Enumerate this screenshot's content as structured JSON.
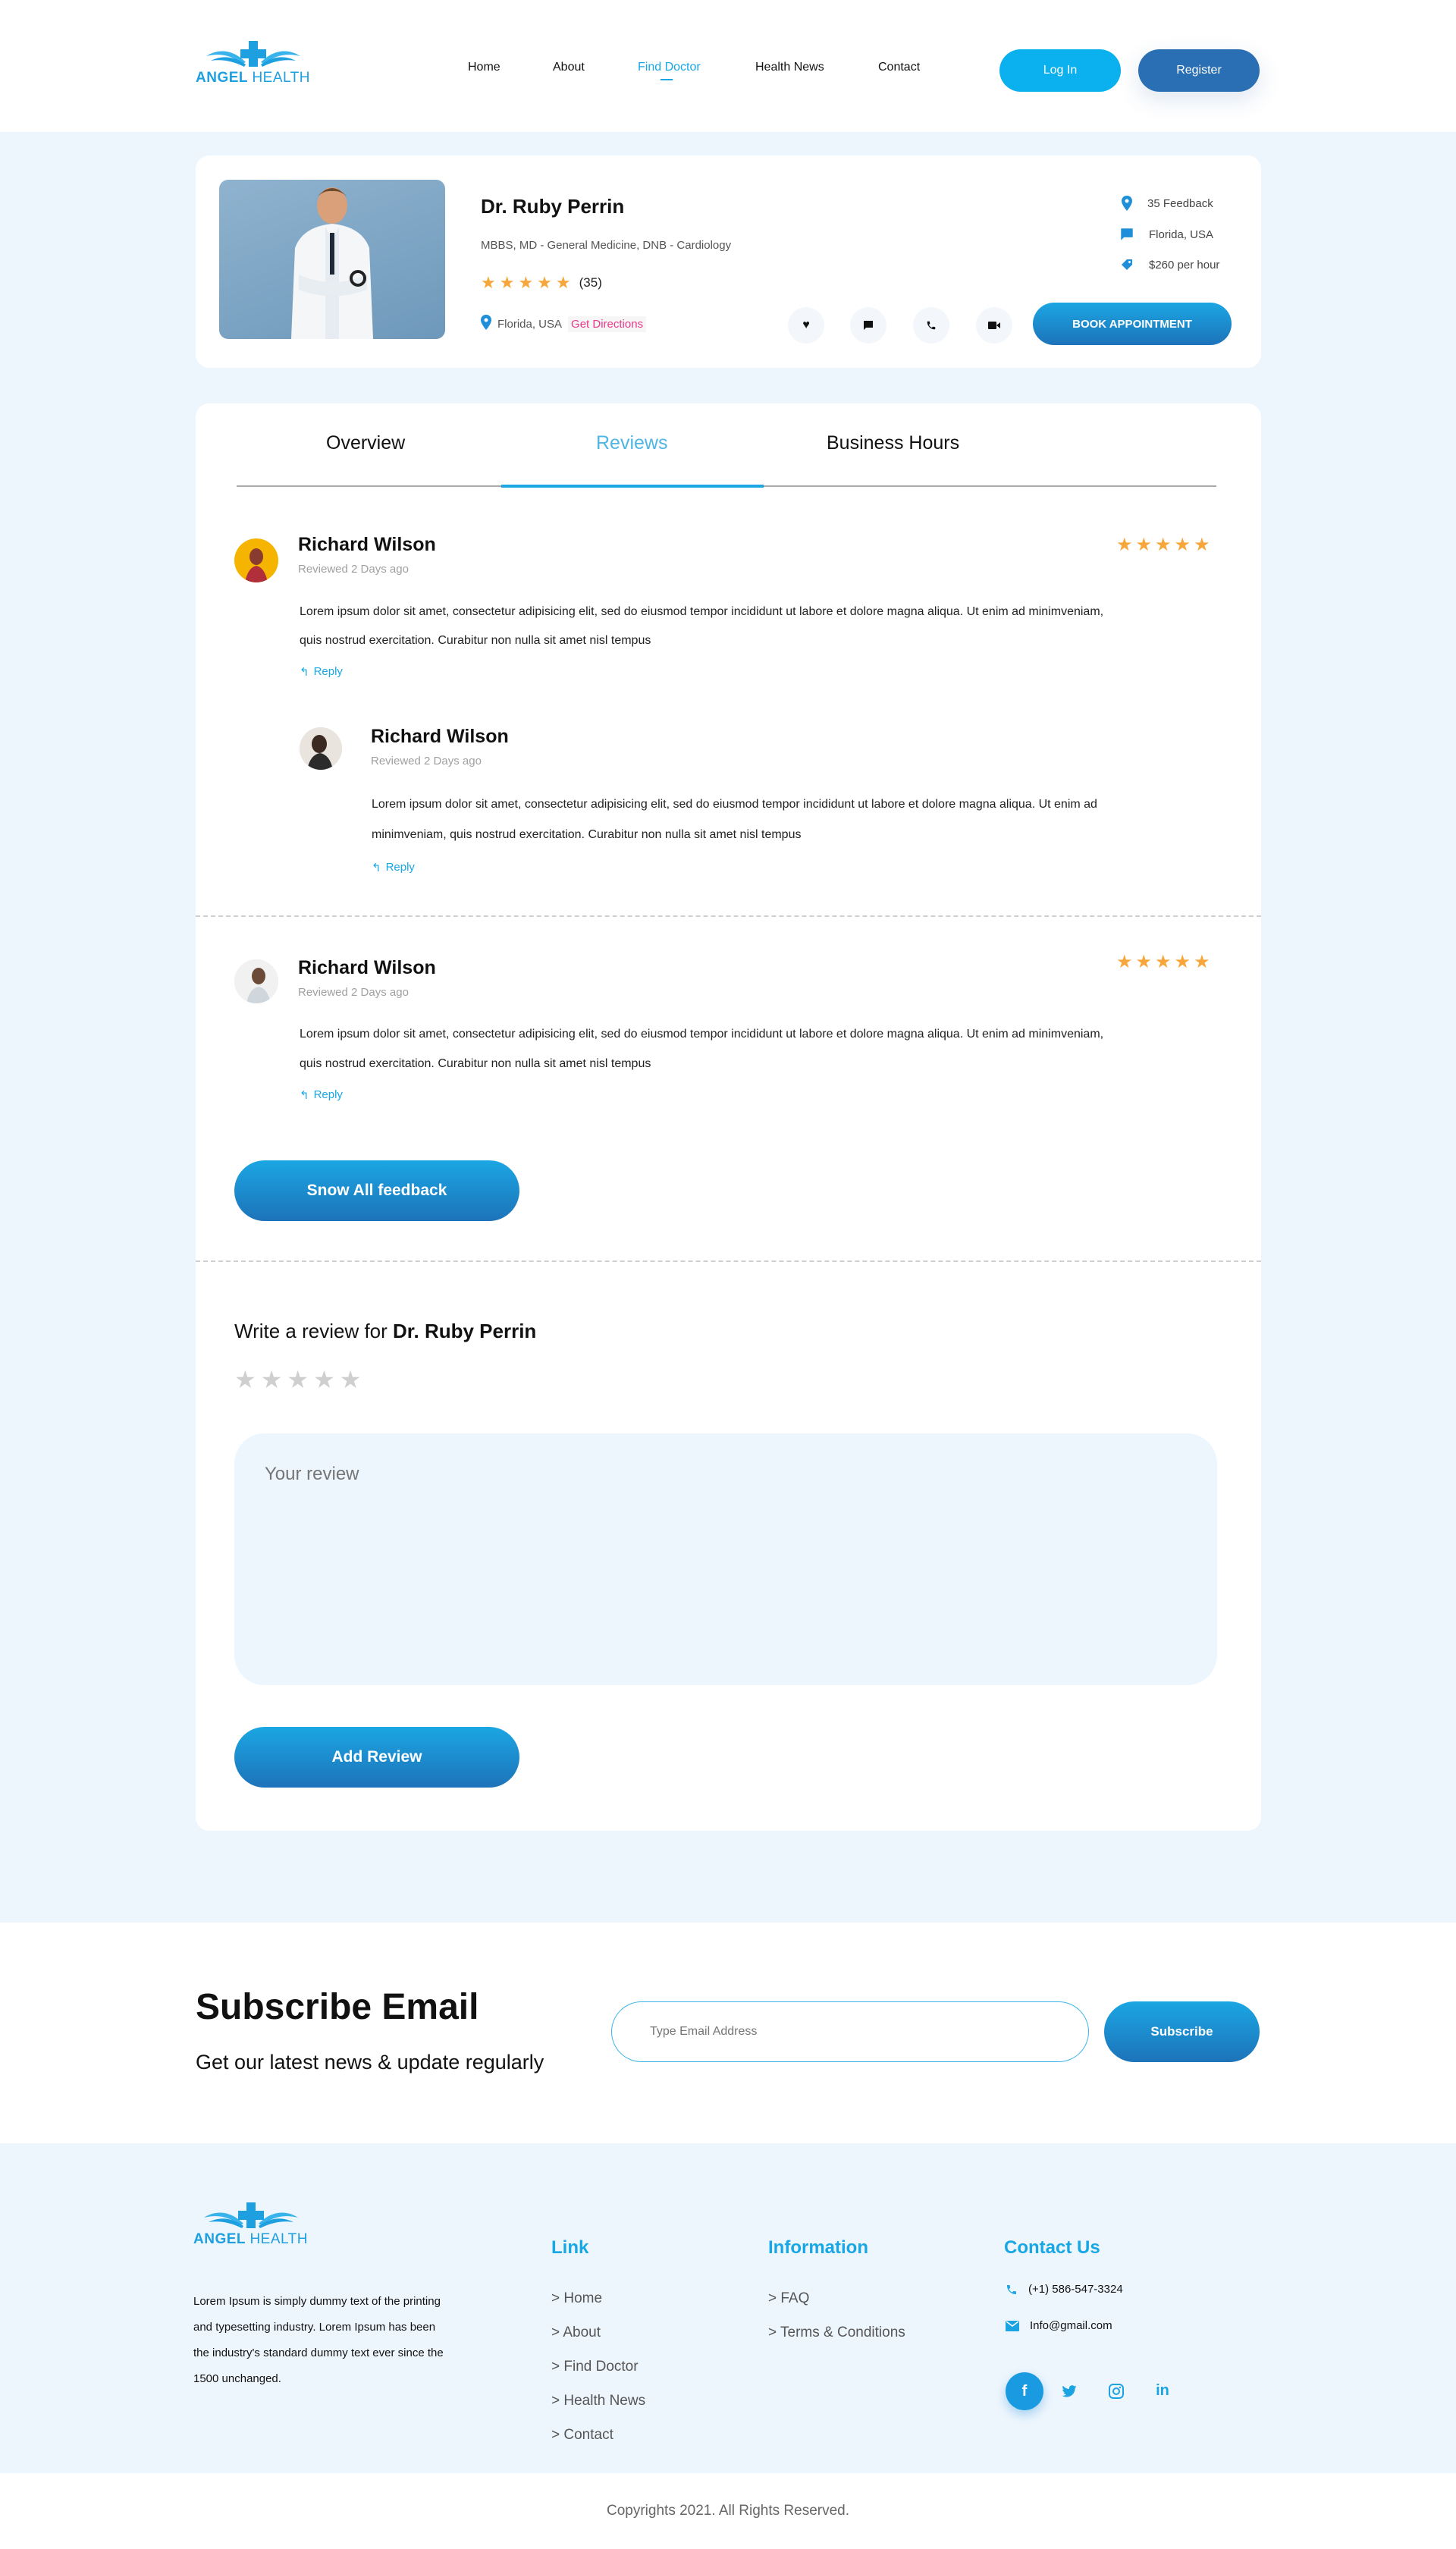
{
  "brand": {
    "name_bold": "ANGEL",
    "name_light": "HEALTH"
  },
  "nav": {
    "items": [
      "Home",
      "About",
      "Find Doctor",
      "Health News",
      "Contact"
    ],
    "login": "Log In",
    "register": "Register"
  },
  "doctor": {
    "name": "Dr. Ruby Perrin",
    "credentials": "MBBS, MD - General Medicine, DNB - Cardiology",
    "rating_count": "(35)",
    "location": "Florida, USA",
    "directions": "Get Directions",
    "feedback": "35 Feedback",
    "location2": "Florida, USA",
    "price": "$260 per hour",
    "book": "BOOK APPOINTMENT"
  },
  "tabs": [
    "Overview",
    "Reviews",
    "Business Hours"
  ],
  "reviews": [
    {
      "name": "Richard Wilson",
      "date": "Reviewed 2 Days ago",
      "text1": "Lorem ipsum dolor sit amet, consectetur adipisicing elit, sed do eiusmod tempor incididunt ut labore et dolore magna aliqua. Ut enim ad minimveniam,",
      "text2": "quis nostrud exercitation. Curabitur non nulla sit amet nisl tempus",
      "reply": "Reply"
    },
    {
      "name": "Richard Wilson",
      "date": "Reviewed 2 Days ago",
      "text1": "Lorem ipsum dolor sit amet, consectetur adipisicing elit, sed do eiusmod tempor incididunt ut labore et dolore magna aliqua. Ut enim ad",
      "text2": "minimveniam, quis nostrud exercitation. Curabitur non nulla sit amet nisl tempus",
      "reply": "Reply"
    },
    {
      "name": "Richard Wilson",
      "date": "Reviewed 2 Days ago",
      "text1": "Lorem ipsum dolor sit amet, consectetur adipisicing elit, sed do eiusmod tempor incididunt ut labore et dolore magna aliqua. Ut enim ad minimveniam,",
      "text2": "quis nostrud exercitation. Curabitur non nulla sit amet nisl tempus",
      "reply": "Reply"
    }
  ],
  "show_all": "Snow All feedback",
  "write": {
    "prefix": "Write a review for",
    "doctor": "Dr. Ruby Perrin",
    "placeholder": "Your review",
    "add": "Add Review"
  },
  "subscribe": {
    "title": "Subscribe Email",
    "subtitle": "Get our latest news & update regularly",
    "placeholder": "Type Email Address",
    "button": "Subscribe"
  },
  "footer": {
    "about": [
      "Lorem Ipsum is simply dummy text of the printing",
      "and typesetting industry. Lorem Ipsum has been",
      "the industry's standard dummy text ever since the",
      "1500 unchanged."
    ],
    "link_title": "Link",
    "links": [
      "> Home",
      "> About",
      "> Find Doctor",
      "> Health News",
      "> Contact"
    ],
    "info_title": "Information",
    "info": [
      "> FAQ",
      "> Terms & Conditions"
    ],
    "contact_title": "Contact Us",
    "phone": "(+1) 586-547-3324",
    "email": "Info@gmail.com",
    "copyright": "Copyrights 2021. All Rights Reserved."
  },
  "colors": {
    "accent": "#17a7e5",
    "accent_dark": "#1d73b9",
    "star": "#f6a63b",
    "pink": "#e8388a",
    "bg": "#eef6fd"
  }
}
